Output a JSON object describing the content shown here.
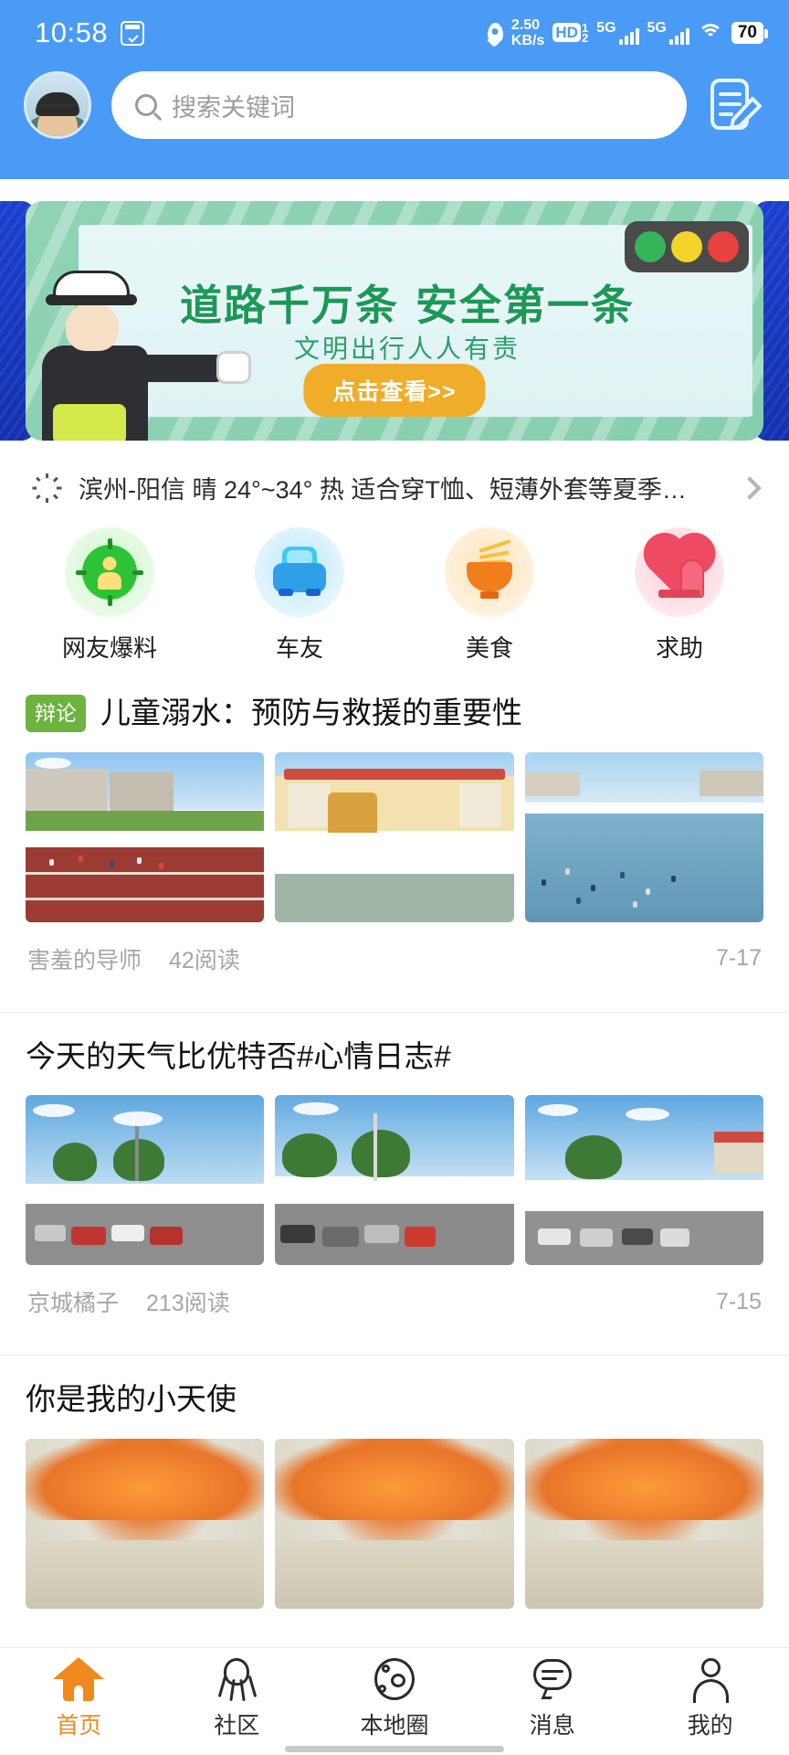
{
  "statusbar": {
    "time": "10:58",
    "net_speed": "2.50",
    "net_unit": "KB/s",
    "hd_label": "HD",
    "sim1": "1",
    "sim2": "2",
    "net1": "5G",
    "net2": "5G",
    "battery": "70",
    "icons": [
      "screenshot-icon",
      "location-pin-icon",
      "hd-icon",
      "signal-icon",
      "wifi-icon",
      "battery-icon"
    ]
  },
  "header": {
    "avatar_alt": "user-avatar",
    "search_placeholder": "搜索关键词",
    "search_value": "",
    "compose_icon": "compose-post-icon"
  },
  "banner": {
    "title": "道路千万条 安全第一条",
    "subtitle": "文明出行人人有责",
    "button": "点击查看>>",
    "traffic_light_colors": [
      "#35b45a",
      "#f2d42a",
      "#e8423f"
    ],
    "bg_color": "#8fd3b4",
    "title_color": "#1a9957",
    "button_color": "#f0ad2a"
  },
  "weather": {
    "icon": "sun-icon",
    "text": "滨州-阳信 晴 24°~34° 热 适合穿T恤、短薄外套等夏季…",
    "location": "滨州-阳信",
    "condition": "晴",
    "temp_range": "24°~34°",
    "feel": "热",
    "advice": "适合穿T恤、短薄外套等夏季…"
  },
  "categories": [
    {
      "label": "网友爆料",
      "icon": "broadcast-person-icon",
      "color": "#2ec336"
    },
    {
      "label": "车友",
      "icon": "car-icon",
      "color": "#2f9fe8"
    },
    {
      "label": "美食",
      "icon": "noodle-bowl-icon",
      "color": "#ef7e1b"
    },
    {
      "label": "求助",
      "icon": "heart-hand-icon",
      "color": "#ef4a63"
    }
  ],
  "posts": [
    {
      "tag": "辩论",
      "title": "儿童溺水：预防与救援的重要性",
      "author": "害羞的导师",
      "reads": "42阅读",
      "date": "7-17",
      "thumbs": [
        "school-track-photo",
        "kindergarten-building-photo",
        "children-in-water-photo"
      ]
    },
    {
      "tag": "",
      "title": "今天的天气比优特否#心情日志#",
      "author": "京城橘子",
      "reads": "213阅读",
      "date": "7-15",
      "thumbs": [
        "street-cars-photo-1",
        "street-cars-photo-2",
        "street-cars-photo-3"
      ]
    },
    {
      "tag": "",
      "title": "你是我的小天使",
      "author": "",
      "reads": "",
      "date": "",
      "thumbs": [
        "baked-bread-photo-1",
        "baked-bread-photo-2",
        "baked-bread-photo-3"
      ]
    }
  ],
  "tabbar": {
    "active_color": "#f08a1e",
    "items": [
      {
        "label": "首页",
        "icon": "home-icon",
        "active": true
      },
      {
        "label": "社区",
        "icon": "community-icon",
        "active": false
      },
      {
        "label": "本地圈",
        "icon": "local-circle-icon",
        "active": false
      },
      {
        "label": "消息",
        "icon": "message-bubble-icon",
        "active": false
      },
      {
        "label": "我的",
        "icon": "profile-person-icon",
        "active": false
      }
    ]
  }
}
